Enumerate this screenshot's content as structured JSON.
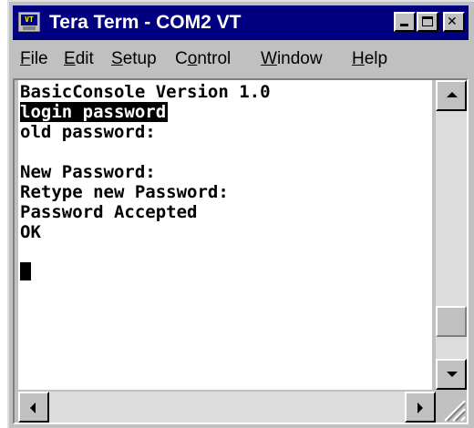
{
  "window": {
    "title": "Tera Term - COM2 VT",
    "icon_label": "VT"
  },
  "menu": [
    {
      "label": "File",
      "accel": "F",
      "rest": "ile"
    },
    {
      "label": "Edit",
      "accel": "E",
      "rest": "dit"
    },
    {
      "label": "Setup",
      "accel": "S",
      "rest": "etup"
    },
    {
      "label": "Control",
      "accel": "o",
      "pre": "C",
      "rest": "ntrol"
    },
    {
      "label": "Window",
      "accel": "W",
      "rest": "indow"
    },
    {
      "label": "Help",
      "accel": "H",
      "rest": "elp"
    }
  ],
  "terminal": {
    "lines": [
      "BasicConsole Version 1.0",
      "login password",
      "old password:",
      "",
      "New Password:",
      "Retype new Password:",
      "Password Accepted",
      "OK"
    ],
    "selected_line_index": 1
  },
  "icons": {
    "minimize": "minimize-icon",
    "maximize": "maximize-icon",
    "close": "close-icon",
    "scroll_up": "arrow-up-icon",
    "scroll_down": "arrow-down-icon",
    "scroll_left": "arrow-left-icon",
    "scroll_right": "arrow-right-icon",
    "resize": "resize-grip-icon"
  },
  "colors": {
    "titlebar": "#000080",
    "face": "#c0c0c0",
    "terminal_bg": "#ffffff",
    "terminal_fg": "#000000"
  }
}
